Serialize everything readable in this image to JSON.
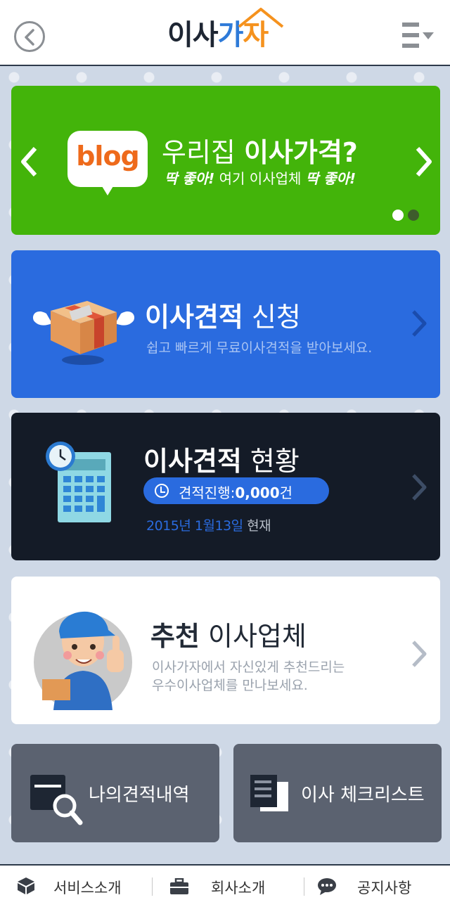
{
  "header": {
    "logo_part1": "이사",
    "logo_part2": "가",
    "logo_part3": "자"
  },
  "banner": {
    "badge": "blog",
    "title_regular": "우리집 ",
    "title_bold": "이사가격?",
    "sub_bold1": "딱 좋아!",
    "sub_regular": " 여기 이사업체 ",
    "sub_bold2": "딱 좋아!",
    "colors": {
      "background": "#43b40a",
      "badge_text": "#ee6a1b",
      "dot_active": "#ffffff",
      "dot_inactive": "#3e5c2c"
    }
  },
  "estimate_card": {
    "title_bold": "이사견적",
    "title_regular": " 신청",
    "description": "쉽고 빠르게 무료이사견적을 받아보세요.",
    "colors": {
      "background": "#2a6bdf"
    }
  },
  "status_card": {
    "title_bold": "이사견적",
    "title_regular": " 현황",
    "progress_label": "견적진행:",
    "progress_count": "0,000",
    "progress_unit": "건",
    "date": "2015년 1월13일",
    "date_suffix": " 현재",
    "colors": {
      "background": "#141b27",
      "date": "#2a6bdf"
    }
  },
  "recommend_card": {
    "title_bold": "추천",
    "title_regular": " 이사업체",
    "description_line1": "이사가자에서 자신있게 추천드리는",
    "description_line2": "우수이사업체를 만나보세요.",
    "colors": {
      "background": "#ffffff"
    }
  },
  "quick_buttons": {
    "my_estimates": "나의견적내역",
    "checklist": "이사 체크리스트"
  },
  "footer": {
    "items": [
      {
        "label": "서비스소개",
        "icon": "box-icon"
      },
      {
        "label": "회사소개",
        "icon": "briefcase-icon"
      },
      {
        "label": "공지사항",
        "icon": "chat-icon"
      }
    ]
  },
  "colors": {
    "page_background": "#ced8e6",
    "logo_dark": "#1e2633",
    "logo_accent": "#2e7ad8",
    "logo_orange": "#f5921e",
    "tile_background": "#5b6270"
  }
}
